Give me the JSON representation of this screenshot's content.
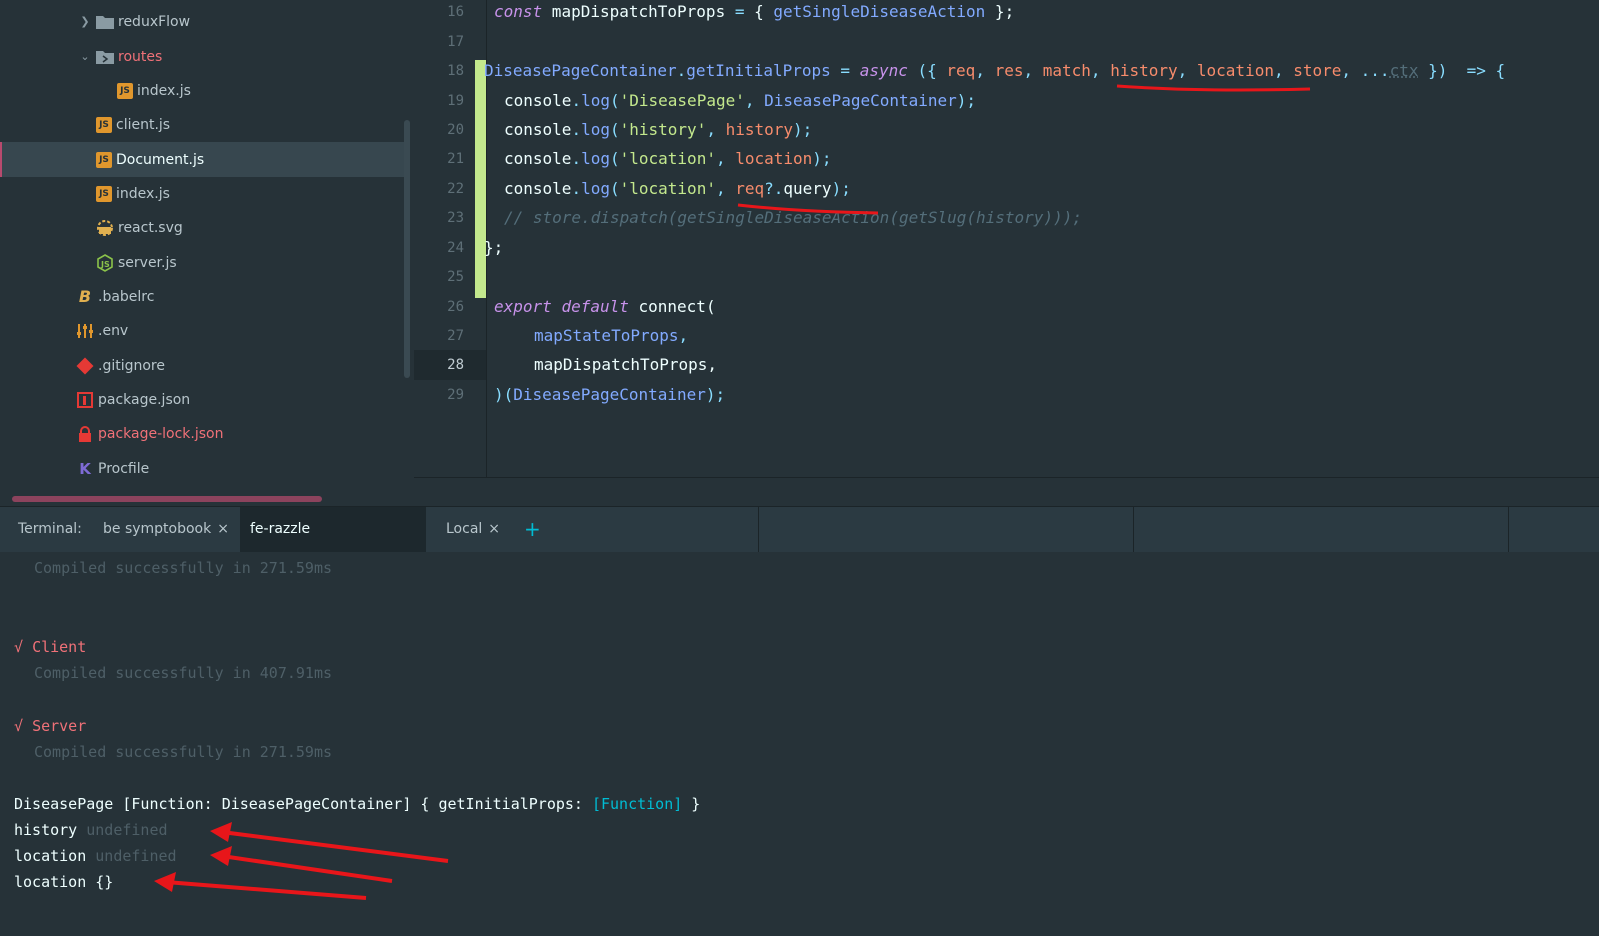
{
  "sidebar": {
    "items": [
      {
        "label": "reduxFlow",
        "icon": "folder-icon"
      },
      {
        "label": "routes",
        "icon": "folder-open-icon"
      },
      {
        "label": "index.js",
        "icon": "js-file-icon"
      },
      {
        "label": "client.js",
        "icon": "js-file-icon"
      },
      {
        "label": "Document.js",
        "icon": "js-file-icon"
      },
      {
        "label": "index.js",
        "icon": "js-file-icon"
      },
      {
        "label": "react.svg",
        "icon": "svg-file-icon"
      },
      {
        "label": "server.js",
        "icon": "node-js-icon"
      },
      {
        "label": ".babelrc",
        "icon": "babel-icon"
      },
      {
        "label": ".env",
        "icon": "settings-sliders-icon"
      },
      {
        "label": ".gitignore",
        "icon": "git-icon"
      },
      {
        "label": "package.json",
        "icon": "npm-icon"
      },
      {
        "label": "package-lock.json",
        "icon": "lock-icon"
      },
      {
        "label": "Procfile",
        "icon": "heroku-icon"
      }
    ]
  },
  "editor": {
    "line_numbers": [
      "16",
      "17",
      "18",
      "19",
      "20",
      "21",
      "22",
      "23",
      "24",
      "25",
      "26",
      "27",
      "28",
      "29"
    ],
    "line16": {
      "a": "const",
      "b": " mapDispatchToProps ",
      "c": "=",
      "d": " { ",
      "e": "getSingleDiseaseAction",
      "f": " };"
    },
    "line18": {
      "a": "DiseasePageContainer",
      "b": ".",
      "c": "getInitialProps",
      "d": " = ",
      "e": "async",
      "f": " ({ ",
      "g": "req",
      "h": ", ",
      "i": "res",
      "j": ", ",
      "k": "match",
      "l": ", ",
      "m": "history",
      "n": ", ",
      "o": "location",
      "p": ", ",
      "q": "store",
      "r": ", ...",
      "s": "ctx",
      "t": " })  ",
      "u": "=>",
      "v": " {"
    },
    "line19": {
      "a": "console",
      "b": ".",
      "c": "log",
      "d": "(",
      "e": "'DiseasePage'",
      "f": ", ",
      "g": "DiseasePageContainer",
      "h": ");"
    },
    "line20": {
      "a": "console",
      "b": ".",
      "c": "log",
      "d": "(",
      "e": "'history'",
      "f": ", ",
      "g": "history",
      "h": ");"
    },
    "line21": {
      "a": "console",
      "b": ".",
      "c": "log",
      "d": "(",
      "e": "'location'",
      "f": ", ",
      "g": "location",
      "h": ");"
    },
    "line22": {
      "a": "console",
      "b": ".",
      "c": "log",
      "d": "(",
      "e": "'location'",
      "f": ", ",
      "g": "req",
      "h": "?.",
      "i": "query",
      "j": ");"
    },
    "line23": "// store.dispatch(getSingleDiseaseAction(getSlug(history)));",
    "line24": "};",
    "line26": {
      "a": "export",
      "b": " ",
      "c": "default",
      "d": " connect("
    },
    "line27": {
      "a": "mapStateToProps",
      "b": ","
    },
    "line28": {
      "a": "mapDispatchToProps,"
    },
    "line29": {
      "a": ")(",
      "b": "DiseasePageContainer",
      "c": ");"
    }
  },
  "terminal": {
    "label": "Terminal:",
    "tabs": [
      {
        "label": "be symptobook",
        "close": "×"
      },
      {
        "label": "fe-razzle symptobook",
        "close": "×"
      },
      {
        "label": "Local",
        "close": "×"
      }
    ],
    "add": "+",
    "lines": {
      "c1": "Compiled successfully in 271.59ms",
      "client_check": "√",
      "client": "Client",
      "c2": "Compiled successfully in 407.91ms",
      "server_check": "√",
      "server": "Server",
      "c3": "Compiled successfully in 271.59ms",
      "dp_a": "DiseasePage [Function: DiseasePageContainer] { getInitialProps: ",
      "dp_b": "[Function]",
      "dp_c": " }",
      "h_a": "history ",
      "h_b": "undefined",
      "l_a": "location ",
      "l_b": "undefined",
      "l2": "location {}"
    }
  },
  "colors": {
    "annotation_red": "#e8161a",
    "accent": "#00bcd4",
    "background": "#263238"
  }
}
